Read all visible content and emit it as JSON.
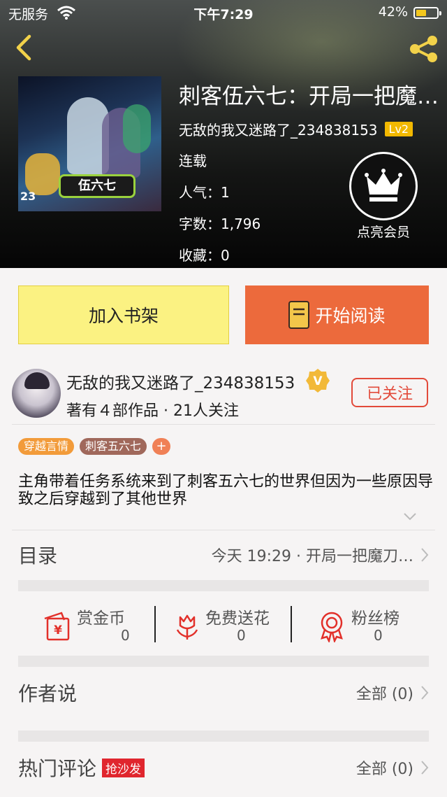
{
  "status_bar": {
    "carrier": "无服务",
    "time": "下午7:29",
    "battery": "42%"
  },
  "book": {
    "title": "刺客伍六七：开局一把魔…",
    "author": "无敌的我又迷路了_234838153",
    "level": "Lv2",
    "status": "连载",
    "popularity_label": "人气：",
    "popularity": "1",
    "words_label": "字数：",
    "words": "1,796",
    "favorites_label": "收藏：",
    "favorites": "0",
    "cover_number": "23"
  },
  "vip": {
    "label": "点亮会员"
  },
  "buttons": {
    "add_shelf": "加入书架",
    "start_reading": "开始阅读"
  },
  "author_card": {
    "name": "无敌的我又迷路了_234838153",
    "stats": "著有４部作品 · 21人关注",
    "follow_label": "已关注"
  },
  "tags": [
    "穿越言情",
    "刺客五六七"
  ],
  "tag_add": "+",
  "description": "主角带着任务系统来到了刺客五六七的世界但因为一些原因导致之后穿越到了其他世界",
  "catalog": {
    "label": "目录",
    "latest": "今天 19:29 · 开局一把魔刀…"
  },
  "actions": [
    {
      "name": "赏金币",
      "count": "0"
    },
    {
      "name": "免费送花",
      "count": "0"
    },
    {
      "name": "粉丝榜",
      "count": "0"
    }
  ],
  "author_says": {
    "label": "作者说",
    "all": "全部 (0)"
  },
  "comments": {
    "label": "热门评论",
    "badge": "抢沙发",
    "all": "全部 (0)"
  },
  "colors": {
    "accent_orange": "#ec6a3c",
    "shelf_yellow": "#fbf282",
    "red": "#e24a3a",
    "gold": "#f2b800"
  }
}
